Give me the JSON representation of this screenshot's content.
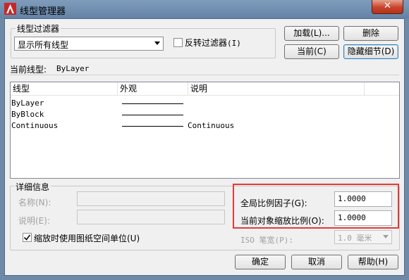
{
  "window": {
    "title": "线型管理器",
    "close_label": "✕"
  },
  "filter": {
    "group_label": "线型过滤器",
    "selected": "显示所有线型",
    "invert_label": "反转过滤器",
    "invert_hotkey": "(I)",
    "invert_checked": false
  },
  "buttons": {
    "load": "加载(L)...",
    "delete": "删除",
    "current": "当前(C)",
    "hide_details": "隐藏细节(D)",
    "ok": "确定",
    "cancel": "取消",
    "help": "帮助(H)"
  },
  "current_linetype": {
    "label": "当前线型:",
    "value": "ByLayer"
  },
  "table": {
    "columns": [
      "线型",
      "外观",
      "说明"
    ],
    "rows": [
      {
        "name": "ByLayer",
        "description": ""
      },
      {
        "name": "ByBlock",
        "description": ""
      },
      {
        "name": "Continuous",
        "description": "Continuous"
      }
    ]
  },
  "details": {
    "group_label": "详细信息",
    "name_label": "名称(N):",
    "desc_label": "说明(E):",
    "paper_space_label": "缩放时使用图纸空间单位(U)",
    "paper_space_checked": true,
    "global_scale_label": "全局比例因子(G):",
    "global_scale_value": "1.0000",
    "object_scale_label": "当前对象缩放比例(O):",
    "object_scale_value": "1.0000",
    "iso_pen_label": "ISO 笔宽(P):",
    "iso_pen_value": "1.0 毫米"
  },
  "colors": {
    "highlight": "#e53935",
    "titlebar": "#7f9cbc",
    "close": "#c8432b"
  }
}
